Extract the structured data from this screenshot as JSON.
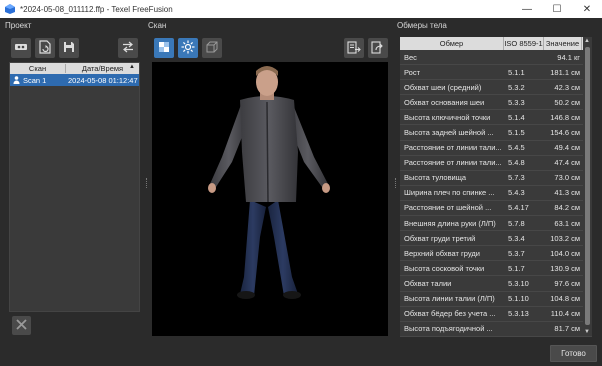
{
  "window": {
    "title": "*2024-05-08_011112.ffp - Texel FreeFusion",
    "minimize": "—",
    "maximize": "☐",
    "close": "✕"
  },
  "project": {
    "label": "Проект",
    "columns": [
      "Скан",
      "Дата/Время"
    ],
    "rows": [
      {
        "name": "Scan 1",
        "date": "2024-05-08 01:12:47"
      }
    ]
  },
  "scan": {
    "label": "Скан"
  },
  "measurements": {
    "label": "Обмеры тела",
    "columns": [
      "Обмер",
      "ISO 8559-1",
      "Значение"
    ],
    "rows": [
      {
        "name": "Вес",
        "iso": "",
        "value": "94.1 кг"
      },
      {
        "name": "Рост",
        "iso": "5.1.1",
        "value": "181.1 см"
      },
      {
        "name": "Обхват шеи (средний)",
        "iso": "5.3.2",
        "value": "42.3 см"
      },
      {
        "name": "Обхват основания шеи",
        "iso": "5.3.3",
        "value": "50.2 см"
      },
      {
        "name": "Высота ключичной точки",
        "iso": "5.1.4",
        "value": "146.8 см"
      },
      {
        "name": "Высота задней шейной ...",
        "iso": "5.1.5",
        "value": "154.6 см"
      },
      {
        "name": "Расстояние от линии тали...",
        "iso": "5.4.5",
        "value": "49.4 см"
      },
      {
        "name": "Расстояние от линии тали...",
        "iso": "5.4.8",
        "value": "47.4 см"
      },
      {
        "name": "Высота туловища",
        "iso": "5.7.3",
        "value": "73.0 см"
      },
      {
        "name": "Ширина плеч по спинке ...",
        "iso": "5.4.3",
        "value": "41.3 см"
      },
      {
        "name": "Расстояние от шейной ...",
        "iso": "5.4.17",
        "value": "84.2 см"
      },
      {
        "name": "Внешняя длина руки (Л/П)",
        "iso": "5.7.8",
        "value": "63.1 см"
      },
      {
        "name": "Обхват груди третий",
        "iso": "5.3.4",
        "value": "103.2 см"
      },
      {
        "name": "Верхний обхват груди",
        "iso": "5.3.7",
        "value": "104.0 см"
      },
      {
        "name": "Высота сосковой точки",
        "iso": "5.1.7",
        "value": "130.9 см"
      },
      {
        "name": "Обхват талии",
        "iso": "5.3.10",
        "value": "97.6 см"
      },
      {
        "name": "Высота линии талии (Л/П)",
        "iso": "5.1.10",
        "value": "104.8 см"
      },
      {
        "name": "Обхват бёдер без учета ...",
        "iso": "5.3.13",
        "value": "110.4 см"
      },
      {
        "name": "Высота подъягодичной ...",
        "iso": "",
        "value": "81.7 см"
      }
    ]
  },
  "footer": {
    "done_label": "Готово"
  },
  "colors": {
    "accent": "#3a78b8",
    "selection": "#2e6bb0",
    "background": "#2b2b2b"
  }
}
